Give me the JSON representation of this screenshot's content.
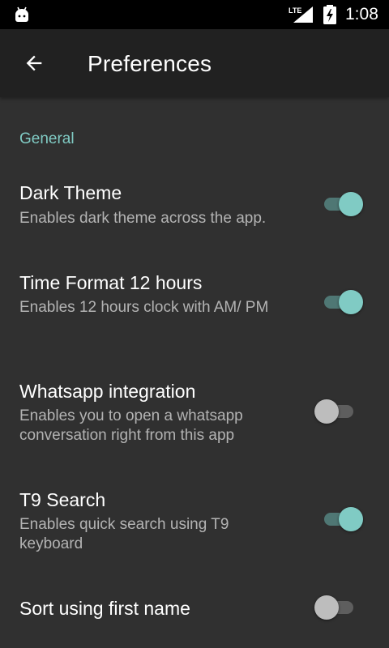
{
  "status_bar": {
    "time": "1:08",
    "network_label": "LTE",
    "icons": [
      "android-debug-icon",
      "lte-signal-icon",
      "battery-charging-icon"
    ]
  },
  "app_bar": {
    "back_icon": "arrow-back-icon",
    "title": "Preferences"
  },
  "colors": {
    "accent": "#80cbc4",
    "background": "#303030",
    "app_bar": "#212121",
    "status_bar": "#000000"
  },
  "section": {
    "header": "General"
  },
  "preferences": [
    {
      "title": "Dark Theme",
      "summary": "Enables dark theme across the app.",
      "enabled": true
    },
    {
      "title": "Time Format 12 hours",
      "summary": "Enables 12 hours clock with AM/ PM",
      "enabled": true
    },
    {
      "title": "Whatsapp integration",
      "summary": "Enables you to open a whatsapp conversation right from this app",
      "enabled": false
    },
    {
      "title": "T9 Search",
      "summary": "Enables quick search using T9 keyboard",
      "enabled": true
    },
    {
      "title": "Sort using first name",
      "summary": "",
      "enabled": false
    }
  ]
}
